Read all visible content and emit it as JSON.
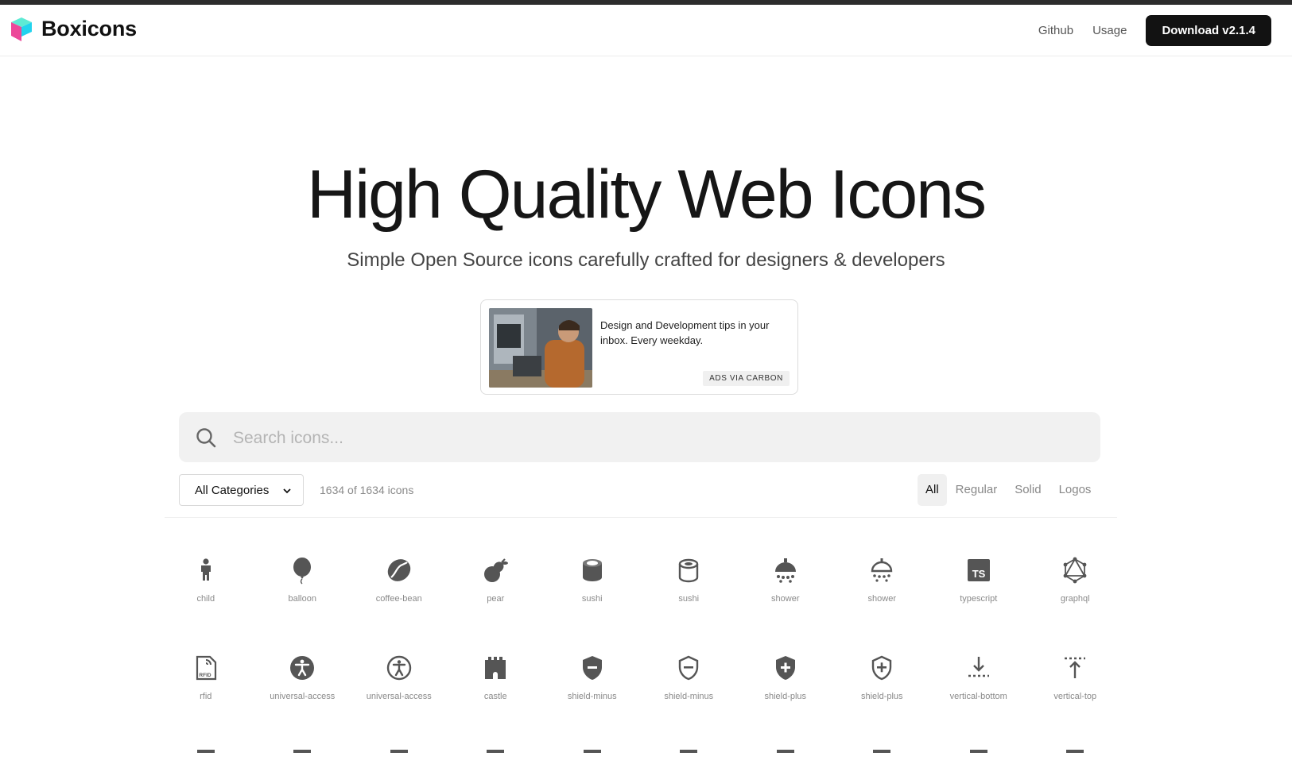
{
  "brand": {
    "name": "Boxicons",
    "logo_icon": "boxicons-cube-logo"
  },
  "nav": {
    "links": [
      "Github",
      "Usage"
    ],
    "download_label": "Download v2.1.4"
  },
  "hero": {
    "title": "High Quality Web Icons",
    "subtitle": "Simple Open Source icons carefully crafted for designers & developers"
  },
  "ad": {
    "text": "Design and Development tips in your inbox. Every weekday.",
    "tag": "ADS VIA CARBON"
  },
  "search": {
    "placeholder": "Search icons...",
    "value": ""
  },
  "filters": {
    "category": "All Categories",
    "count_text": "1634 of 1634 icons",
    "types": [
      "All",
      "Regular",
      "Solid",
      "Logos"
    ],
    "active_type": "All"
  },
  "icons": [
    {
      "label": "child",
      "icon": "child-icon"
    },
    {
      "label": "balloon",
      "icon": "balloon-icon"
    },
    {
      "label": "coffee-bean",
      "icon": "coffee-bean-icon"
    },
    {
      "label": "pear",
      "icon": "pear-icon"
    },
    {
      "label": "sushi",
      "icon": "sushi-solid-icon"
    },
    {
      "label": "sushi",
      "icon": "sushi-regular-icon"
    },
    {
      "label": "shower",
      "icon": "shower-solid-icon"
    },
    {
      "label": "shower",
      "icon": "shower-regular-icon"
    },
    {
      "label": "typescript",
      "icon": "typescript-icon"
    },
    {
      "label": "graphql",
      "icon": "graphql-icon"
    },
    {
      "label": "rfid",
      "icon": "rfid-icon"
    },
    {
      "label": "universal-access",
      "icon": "universal-access-solid-icon"
    },
    {
      "label": "universal-access",
      "icon": "universal-access-regular-icon"
    },
    {
      "label": "castle",
      "icon": "castle-icon"
    },
    {
      "label": "shield-minus",
      "icon": "shield-minus-solid-icon"
    },
    {
      "label": "shield-minus",
      "icon": "shield-minus-regular-icon"
    },
    {
      "label": "shield-plus",
      "icon": "shield-plus-solid-icon"
    },
    {
      "label": "shield-plus",
      "icon": "shield-plus-regular-icon"
    },
    {
      "label": "vertical-bottom",
      "icon": "vertical-bottom-icon"
    },
    {
      "label": "vertical-top",
      "icon": "vertical-top-icon"
    }
  ],
  "colors": {
    "icon": "#555555",
    "button": "#121212",
    "logo_cyan": "#22d3ee",
    "logo_pink": "#ec4899"
  }
}
